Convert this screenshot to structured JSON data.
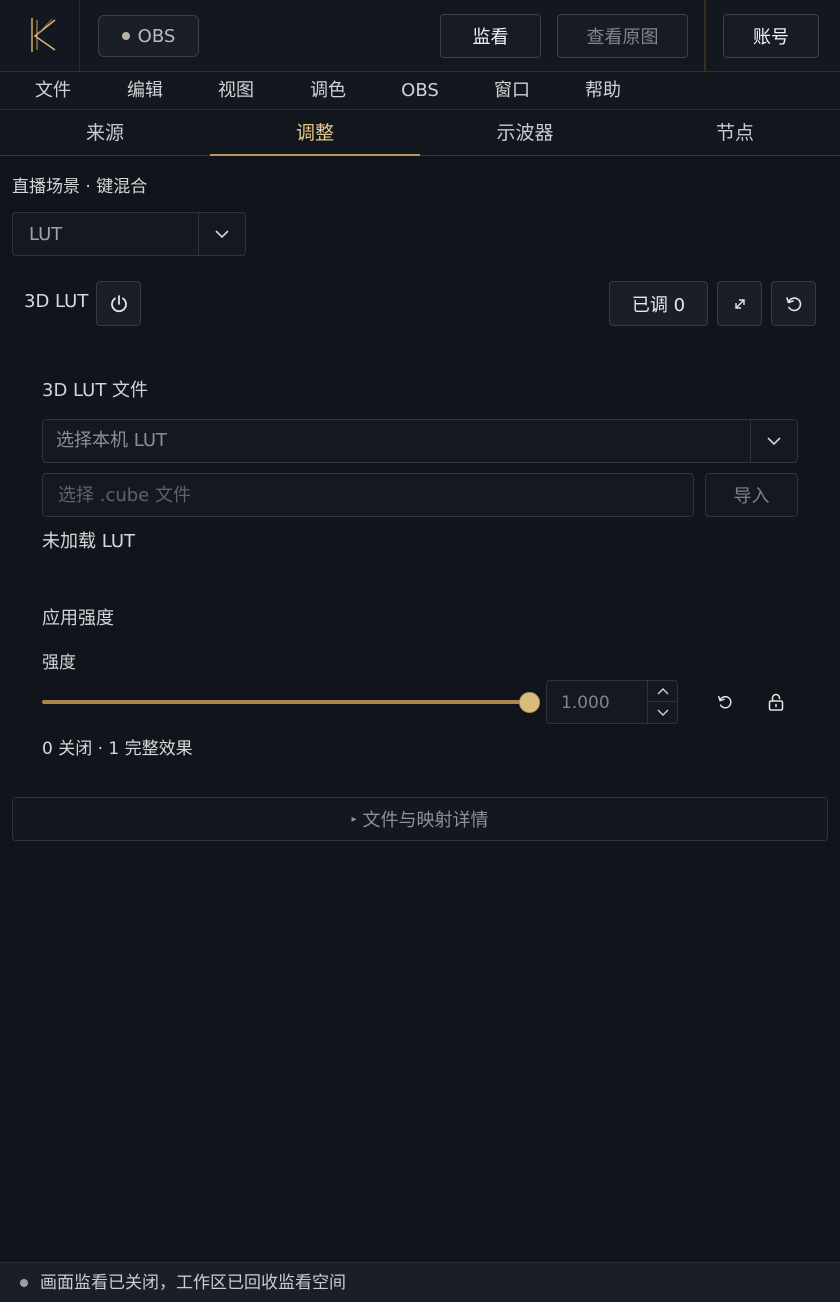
{
  "colors": {
    "background": "#11151b",
    "accent": "#d9bc7b",
    "active_tab": "#e6c98a"
  },
  "header": {
    "logo_icon": "k-logo-icon",
    "obs_label": "OBS",
    "monitor_label": "监看",
    "original_label": "查看原图",
    "account_label": "账号"
  },
  "menu": {
    "items": [
      "文件",
      "编辑",
      "视图",
      "调色",
      "OBS",
      "窗口",
      "帮助"
    ]
  },
  "tabs": {
    "items": [
      "来源",
      "调整",
      "示波器",
      "节点"
    ],
    "active": "调整"
  },
  "breadcrumb": "直播场景 · 键混合",
  "effect_select": {
    "value": "LUT"
  },
  "lut": {
    "label": "3D LUT",
    "adjusted_label": "已调 0",
    "file_title": "3D LUT 文件",
    "local_select_value": "选择本机 LUT",
    "cube_placeholder": "选择 .cube 文件",
    "import_label": "导入",
    "status": "未加载 LUT"
  },
  "strength": {
    "section_title": "应用强度",
    "label": "强度",
    "value": "1.000",
    "fraction": 1.0,
    "range_note": "0 关闭 · 1 完整效果"
  },
  "details_label": "文件与映射详情",
  "status_bar": {
    "text": "画面监看已关闭，工作区已回收监看空间"
  }
}
